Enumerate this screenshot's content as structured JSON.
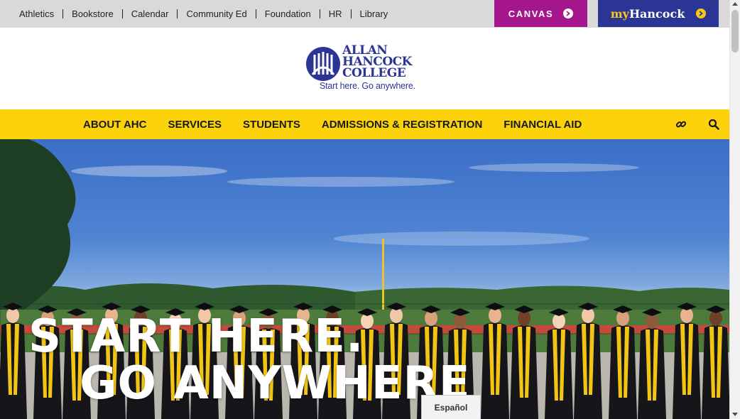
{
  "utility": {
    "links": [
      "Athletics",
      "Bookstore",
      "Calendar",
      "Community Ed",
      "Foundation",
      "HR",
      "Library"
    ],
    "canvas_label": "CANVAS",
    "myhancock_prefix": "my",
    "myhancock_suffix": "Hancock"
  },
  "logo": {
    "line1": "ALLAN",
    "line2": "HANCOCK",
    "line3": "COLLEGE",
    "tagline": "Start here. Go anywhere."
  },
  "nav": {
    "items": [
      "ABOUT AHC",
      "SERVICES",
      "STUDENTS",
      "ADMISSIONS & REGISTRATION",
      "FINANCIAL AID"
    ],
    "link_icon": "link-icon",
    "search_icon": "search-icon"
  },
  "hero": {
    "line1": "START HERE.",
    "line2": "GO ANYWHERE"
  },
  "language_tab": "Español",
  "colors": {
    "canvas": "#a5168c",
    "myhancock": "#2b3594",
    "gold": "#fcd20b",
    "utility_bg": "#d9d9d9",
    "brand_blue": "#2b3594"
  }
}
